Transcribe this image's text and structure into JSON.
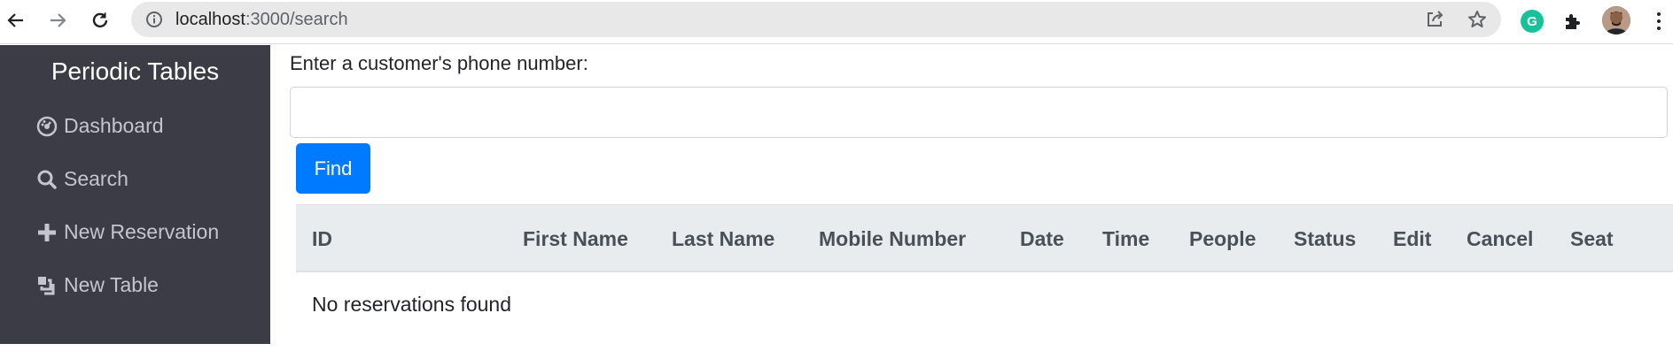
{
  "browser": {
    "url_host": "localhost",
    "url_path": ":3000/search",
    "extension_grammarly": "G",
    "icons": [
      "back-icon",
      "forward-icon",
      "reload-icon",
      "info-icon",
      "share-icon",
      "star-icon",
      "grammarly-icon",
      "puzzle-icon",
      "avatar",
      "kebab-menu-icon"
    ]
  },
  "sidebar": {
    "brand": "Periodic Tables",
    "items": [
      {
        "label": "Dashboard",
        "icon": "dashboard-icon"
      },
      {
        "label": "Search",
        "icon": "search-icon"
      },
      {
        "label": "New Reservation",
        "icon": "plus-icon"
      },
      {
        "label": "New Table",
        "icon": "layers-icon"
      }
    ]
  },
  "search": {
    "label": "Enter a customer's phone number:",
    "input_value": "",
    "find_label": "Find"
  },
  "table": {
    "columns": [
      "ID",
      "First Name",
      "Last Name",
      "Mobile Number",
      "Date",
      "Time",
      "People",
      "Status",
      "Edit",
      "Cancel",
      "Seat"
    ],
    "empty_message": "No reservations found"
  },
  "colors": {
    "sidebar_bg": "#3c3c47",
    "primary": "#007bff",
    "table_header_bg": "#e9ecef"
  }
}
